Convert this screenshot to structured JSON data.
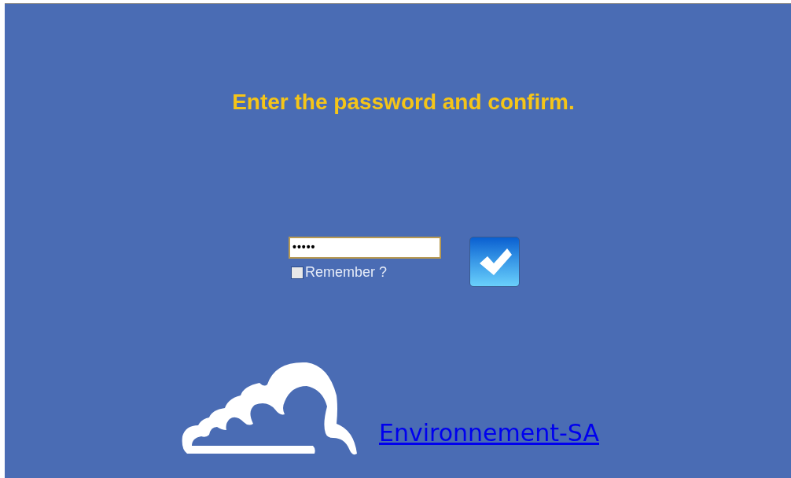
{
  "title": "Enter the password and confirm.",
  "password_field": {
    "value": "•••••"
  },
  "remember": {
    "label": "Remember ?",
    "checked": false
  },
  "link": "Environnement-SA"
}
